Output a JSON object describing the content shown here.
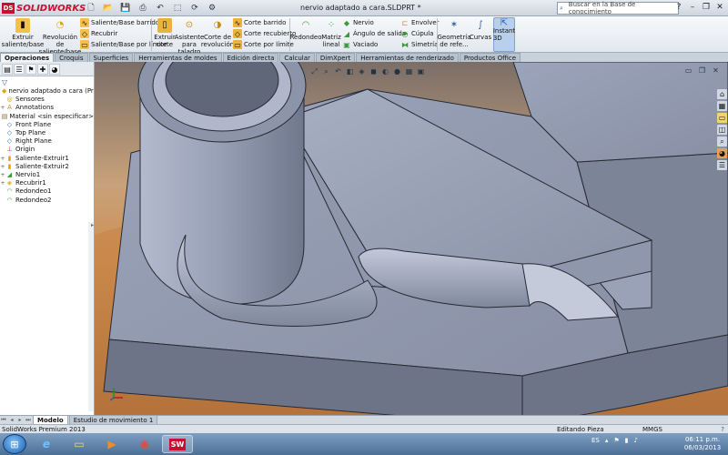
{
  "app": {
    "name": "SOLIDWORKS",
    "doc_title": "nervio adaptado a cara.SLDPRT *",
    "search_placeholder": "Buscar en la Base de conocimiento"
  },
  "ribbon": {
    "extrude_boss": "Extruir saliente/base",
    "revolve_boss": "Revolución de saliente/base",
    "swept_boss": "Saliente/Base barrido",
    "loft": "Recubrir",
    "boundary_boss": "Saliente/Base por límite",
    "extruded_cut": "Extruir corte",
    "hole_wizard": "Asistente para taladro",
    "revolved_cut": "Corte de revolución",
    "swept_cut": "Corte barrido",
    "lofted_cut": "Corte recubierto",
    "boundary_cut": "Corte por límite",
    "fillet": "Redondeo",
    "linear_pattern": "Matriz lineal",
    "rib": "Nervio",
    "draft": "Ángulo de salida",
    "shell": "Vaciado",
    "wrap": "Envolver",
    "dome": "Cúpula",
    "mirror": "Simetría",
    "ref_geometry": "Geometría de refe...",
    "curves": "Curvas",
    "instant3d": "Instant 3D"
  },
  "tabs": [
    "Operaciones",
    "Croquis",
    "Superficies",
    "Herramientas de moldes",
    "Edición directa",
    "Calcular",
    "DimXpert",
    "Herramientas de renderizado",
    "Productos Office"
  ],
  "tree": [
    {
      "label": "nervio adaptado a cara  (Predeterminado",
      "icon": "part-icon",
      "exp": ""
    },
    {
      "label": "Sensores",
      "icon": "sensor-icon",
      "exp": ""
    },
    {
      "label": "Annotations",
      "icon": "annotation-icon",
      "exp": "+"
    },
    {
      "label": "Material <sin especificar>",
      "icon": "material-icon",
      "exp": ""
    },
    {
      "label": "Front Plane",
      "icon": "plane-icon",
      "exp": ""
    },
    {
      "label": "Top Plane",
      "icon": "plane-icon",
      "exp": ""
    },
    {
      "label": "Right Plane",
      "icon": "plane-icon",
      "exp": ""
    },
    {
      "label": "Origin",
      "icon": "origin-icon",
      "exp": ""
    },
    {
      "label": "Saliente-Extruir1",
      "icon": "extrude-icon",
      "exp": "+"
    },
    {
      "label": "Saliente-Extruir2",
      "icon": "extrude-icon",
      "exp": "+"
    },
    {
      "label": "Nervio1",
      "icon": "rib-icon",
      "exp": "+"
    },
    {
      "label": "Recubrir1",
      "icon": "loft-icon",
      "exp": "+"
    },
    {
      "label": "Redondeo1",
      "icon": "fillet-icon",
      "exp": ""
    },
    {
      "label": "Redondeo2",
      "icon": "fillet-icon",
      "exp": ""
    }
  ],
  "bottom_tabs": [
    "Modelo",
    "Estudio de movimiento 1"
  ],
  "status": {
    "product": "SolidWorks Premium 2013",
    "mode": "Editando Pieza",
    "units": "MMGS",
    "help": "?"
  },
  "taskbar": {
    "lang": "ES",
    "time": "06:11 p.m.",
    "date": "06/03/2013"
  },
  "colors": {
    "model_face": "#8a93a7",
    "model_top": "#9aa3b8",
    "model_side": "#6e778a",
    "edge": "#262a33",
    "accent": "#c8102e"
  }
}
